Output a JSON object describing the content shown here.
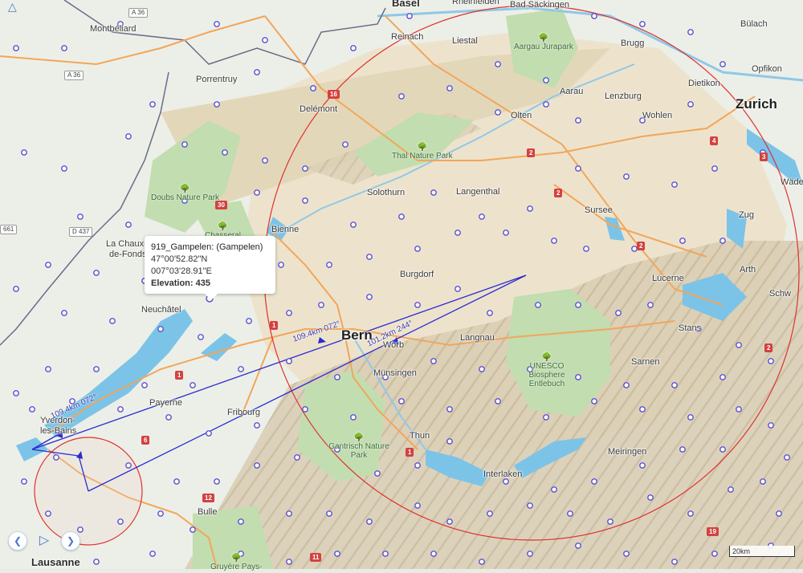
{
  "map": {
    "places": [
      {
        "name": "Basel",
        "cls": "med"
      },
      {
        "name": "Rheinfelden",
        "cls": ""
      },
      {
        "name": "Bad Säckingen",
        "cls": ""
      },
      {
        "name": "Montbéliard",
        "cls": ""
      },
      {
        "name": "Reinach",
        "cls": ""
      },
      {
        "name": "Liestal",
        "cls": ""
      },
      {
        "name": "Brugg",
        "cls": ""
      },
      {
        "name": "Bülach",
        "cls": ""
      },
      {
        "name": "Opfikon",
        "cls": ""
      },
      {
        "name": "Dietikon",
        "cls": ""
      },
      {
        "name": "Zurich",
        "cls": "big"
      },
      {
        "name": "Porrentruy",
        "cls": ""
      },
      {
        "name": "Aarau",
        "cls": ""
      },
      {
        "name": "Lenzburg",
        "cls": ""
      },
      {
        "name": "Delémont",
        "cls": ""
      },
      {
        "name": "Olten",
        "cls": ""
      },
      {
        "name": "Wohlen",
        "cls": ""
      },
      {
        "name": "Solothurn",
        "cls": ""
      },
      {
        "name": "Langenthal",
        "cls": ""
      },
      {
        "name": "Wäde",
        "cls": ""
      },
      {
        "name": "Sursee",
        "cls": ""
      },
      {
        "name": "Zug",
        "cls": ""
      },
      {
        "name": "Bienne",
        "cls": ""
      },
      {
        "name": "La Chaux-",
        "cls": ""
      },
      {
        "name": "de-Fonds",
        "cls": ""
      },
      {
        "name": "Burgdorf",
        "cls": ""
      },
      {
        "name": "Arth",
        "cls": ""
      },
      {
        "name": "Lucerne",
        "cls": ""
      },
      {
        "name": "Schw",
        "cls": ""
      },
      {
        "name": "Neuchâtel",
        "cls": ""
      },
      {
        "name": "Bern",
        "cls": "big"
      },
      {
        "name": "Worb",
        "cls": ""
      },
      {
        "name": "Langnau",
        "cls": ""
      },
      {
        "name": "Stans",
        "cls": ""
      },
      {
        "name": "Sarnen",
        "cls": ""
      },
      {
        "name": "Münsingen",
        "cls": ""
      },
      {
        "name": "Payerne",
        "cls": ""
      },
      {
        "name": "Yverdon-",
        "cls": ""
      },
      {
        "name": "les-Bains",
        "cls": ""
      },
      {
        "name": "Fribourg",
        "cls": ""
      },
      {
        "name": "Thun",
        "cls": ""
      },
      {
        "name": "Meiringen",
        "cls": ""
      },
      {
        "name": "Interlaken",
        "cls": ""
      },
      {
        "name": "Bulle",
        "cls": ""
      },
      {
        "name": "Lausanne",
        "cls": "med"
      }
    ],
    "parks": [
      {
        "name": "Aargau Jurapark"
      },
      {
        "name": "Thal Nature Park"
      },
      {
        "name": "Doubs Nature Park"
      },
      {
        "name": "Chasseral"
      },
      {
        "name": "UNESCO Biosphere Entlebuch"
      },
      {
        "name": "Gantrisch Nature Park"
      },
      {
        "name": "Gruyère Pays-"
      }
    ],
    "roads": [
      "A 36",
      "A 36",
      "D 437",
      "16",
      "30",
      "2",
      "4",
      "3",
      "2",
      "2",
      "2",
      "1",
      "1",
      "6",
      "1",
      "12",
      "11",
      "19",
      "661"
    ],
    "colors": {
      "route": "#2a2ad0",
      "circle": "#e03030",
      "waypoint": "#5a4fd0",
      "water": "#7cc3e8",
      "park": "#bcdcaa"
    }
  },
  "routes": [
    {
      "label": "109.4km 072°"
    },
    {
      "label": "101.2km 244°"
    },
    {
      "label": "109.4km 072°"
    }
  ],
  "popup": {
    "title": "919_Gampelen: (Gampelen)",
    "coords": "47°00'52.82\"N 007°03'28.91\"E",
    "elevation": "Elevation: 435"
  },
  "controls": {
    "prev_icon": "chevron-left-icon",
    "play_icon": "play-icon",
    "next_icon": "chevron-right-icon"
  },
  "scale": {
    "label": "20km"
  }
}
